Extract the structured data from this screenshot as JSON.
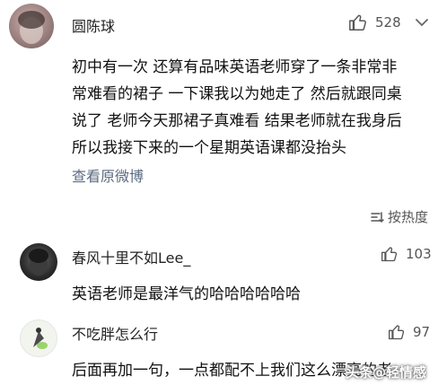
{
  "comments": [
    {
      "author": "圆陈球",
      "likes": "528",
      "lines": [
        "初中有一次 还算有品味英语老师穿了一条非常非",
        "常难看的裙子 一下课我以为她走了 然后就跟同桌",
        "说了 老师今天那裙子真难看 结果老师就在我身后",
        "所以我接下来的一个星期英语课都没抬头"
      ],
      "view_original": "查看原微博"
    }
  ],
  "sort": {
    "label": "按热度"
  },
  "replies": [
    {
      "author": "春风十里不如Lee_",
      "likes": "103",
      "text": "英语老师是最洋气的哈哈哈哈哈哈"
    },
    {
      "author": "不吃胖怎么行",
      "likes": "97",
      "text": "后面再加一句，一点都配不上我们这么漂亮的老"
    }
  ],
  "watermark": "头条@轻情感"
}
